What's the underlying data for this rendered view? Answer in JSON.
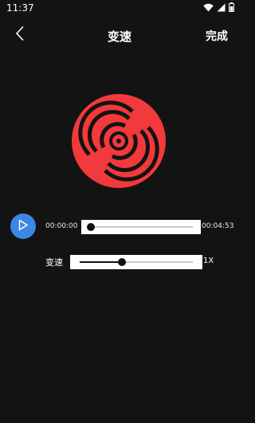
{
  "status_bar": {
    "time": "11:37",
    "icons": [
      "wifi-icon",
      "cell-signal-icon",
      "battery-icon"
    ]
  },
  "nav": {
    "back_icon": "chevron-left-icon",
    "title": "变速",
    "done_label": "完成"
  },
  "artwork": {
    "icon": "vinyl-disc-icon",
    "color": "#f2393b"
  },
  "player": {
    "play_icon": "play-icon",
    "accent_color": "#3d87e4",
    "current_time": "00:00:00",
    "total_time": "00:04:53",
    "progress": 0.0
  },
  "speed": {
    "label": "变速",
    "value_label": "1X",
    "level": 0.37
  }
}
